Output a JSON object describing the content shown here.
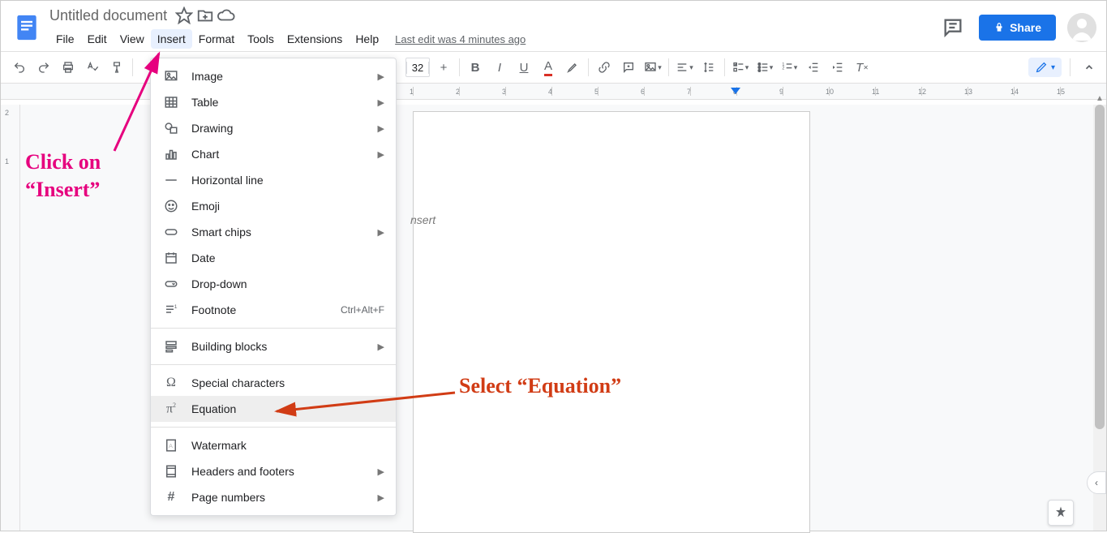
{
  "header": {
    "doc_title": "Untitled document",
    "menu": [
      "File",
      "Edit",
      "View",
      "Insert",
      "Format",
      "Tools",
      "Extensions",
      "Help"
    ],
    "last_edit": "Last edit was 4 minutes ago",
    "share_label": "Share"
  },
  "toolbar": {
    "font_size": "32"
  },
  "ruler": {
    "marks": [
      "1",
      "2",
      "3",
      "4",
      "5",
      "6",
      "7",
      "8",
      "9",
      "10",
      "11",
      "12",
      "13",
      "14",
      "15"
    ]
  },
  "vruler": {
    "marks": [
      "2",
      "1"
    ]
  },
  "page": {
    "visible_text": "nsert"
  },
  "insert_menu": {
    "items": [
      {
        "label": "Image",
        "icon": "image-icon",
        "submenu": true
      },
      {
        "label": "Table",
        "icon": "table-icon",
        "submenu": true
      },
      {
        "label": "Drawing",
        "icon": "drawing-icon",
        "submenu": true
      },
      {
        "label": "Chart",
        "icon": "chart-icon",
        "submenu": true
      },
      {
        "label": "Horizontal line",
        "icon": "hr-icon"
      },
      {
        "label": "Emoji",
        "icon": "emoji-icon"
      },
      {
        "label": "Smart chips",
        "icon": "chips-icon",
        "submenu": true
      },
      {
        "label": "Date",
        "icon": "date-icon"
      },
      {
        "label": "Drop-down",
        "icon": "dropdown-icon"
      },
      {
        "label": "Footnote",
        "icon": "footnote-icon",
        "shortcut": "Ctrl+Alt+F"
      },
      {
        "sep": true
      },
      {
        "label": "Building blocks",
        "icon": "blocks-icon",
        "submenu": true
      },
      {
        "sep": true
      },
      {
        "label": "Special characters",
        "icon": "omega-icon"
      },
      {
        "label": "Equation",
        "icon": "pi-icon",
        "highlight": true
      },
      {
        "sep": true
      },
      {
        "label": "Watermark",
        "icon": "watermark-icon"
      },
      {
        "label": "Headers and footers",
        "icon": "headers-icon",
        "submenu": true
      },
      {
        "label": "Page numbers",
        "icon": "hash-icon",
        "submenu": true
      }
    ]
  },
  "annotations": {
    "insert_line1": "Click on",
    "insert_line2": "“Insert”",
    "equation": "Select “Equation”"
  }
}
